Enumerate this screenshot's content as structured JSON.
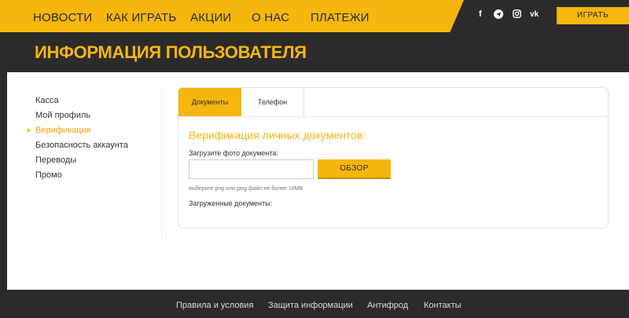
{
  "nav": {
    "items": [
      "НОВОСТИ",
      "КАК ИГРАТЬ",
      "АКЦИИ",
      "О НАС",
      "ПЛАТЕЖИ"
    ],
    "social": [
      "facebook-icon",
      "telegram-icon",
      "instagram-icon",
      "vk-icon"
    ],
    "play_label": "ИГРАТЬ"
  },
  "page": {
    "title": "ИНФОРМАЦИЯ ПОЛЬЗОВАТЕЛЯ"
  },
  "sidebar": {
    "items": [
      {
        "label": "Касса"
      },
      {
        "label": "Мой профиль"
      },
      {
        "label": "Верификация",
        "active": true
      },
      {
        "label": "Безопасность аккаунта"
      },
      {
        "label": "Переводы"
      },
      {
        "label": "Промо"
      }
    ]
  },
  "tabs": [
    {
      "label": "Документы",
      "active": true
    },
    {
      "label": "Телефон"
    }
  ],
  "verification": {
    "heading": "Верификация личных документов:",
    "upload_label": "Загрузите фото документа:",
    "file_value": "",
    "browse_label": "ОБЗОР",
    "hint": "выберите png или jpeg файл не более 10MB",
    "uploaded_label": "Загруженные документы:"
  },
  "footer": {
    "links": [
      "Правила и условия",
      "Защита информации",
      "Антифрод",
      "Контакты"
    ]
  },
  "colors": {
    "accent": "#f6b60e",
    "dark": "#2b2b2b",
    "panel": "#ffffff"
  }
}
